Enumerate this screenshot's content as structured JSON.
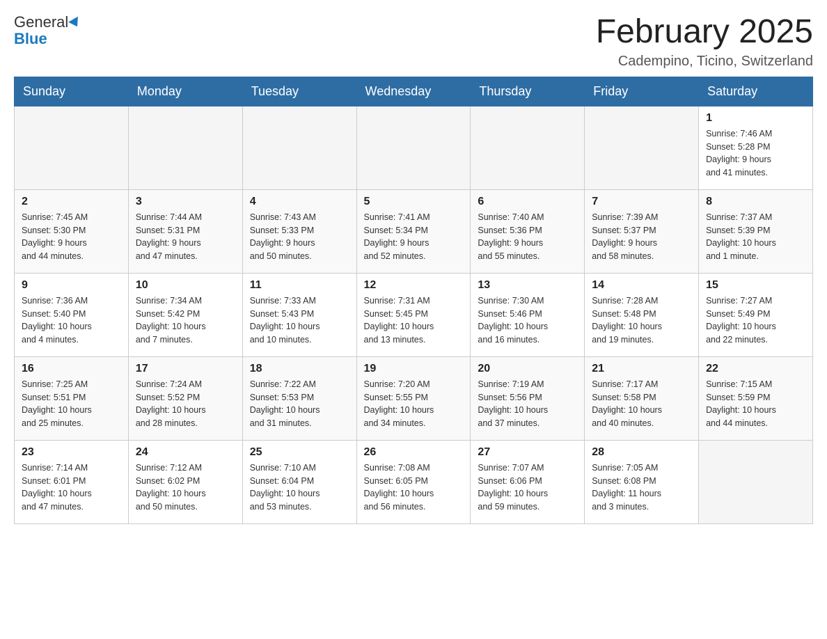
{
  "header": {
    "logo_line1": "General",
    "logo_line2": "Blue",
    "month_title": "February 2025",
    "location": "Cadempino, Ticino, Switzerland"
  },
  "days_of_week": [
    "Sunday",
    "Monday",
    "Tuesday",
    "Wednesday",
    "Thursday",
    "Friday",
    "Saturday"
  ],
  "weeks": [
    {
      "days": [
        {
          "num": "",
          "info": ""
        },
        {
          "num": "",
          "info": ""
        },
        {
          "num": "",
          "info": ""
        },
        {
          "num": "",
          "info": ""
        },
        {
          "num": "",
          "info": ""
        },
        {
          "num": "",
          "info": ""
        },
        {
          "num": "1",
          "info": "Sunrise: 7:46 AM\nSunset: 5:28 PM\nDaylight: 9 hours\nand 41 minutes."
        }
      ]
    },
    {
      "days": [
        {
          "num": "2",
          "info": "Sunrise: 7:45 AM\nSunset: 5:30 PM\nDaylight: 9 hours\nand 44 minutes."
        },
        {
          "num": "3",
          "info": "Sunrise: 7:44 AM\nSunset: 5:31 PM\nDaylight: 9 hours\nand 47 minutes."
        },
        {
          "num": "4",
          "info": "Sunrise: 7:43 AM\nSunset: 5:33 PM\nDaylight: 9 hours\nand 50 minutes."
        },
        {
          "num": "5",
          "info": "Sunrise: 7:41 AM\nSunset: 5:34 PM\nDaylight: 9 hours\nand 52 minutes."
        },
        {
          "num": "6",
          "info": "Sunrise: 7:40 AM\nSunset: 5:36 PM\nDaylight: 9 hours\nand 55 minutes."
        },
        {
          "num": "7",
          "info": "Sunrise: 7:39 AM\nSunset: 5:37 PM\nDaylight: 9 hours\nand 58 minutes."
        },
        {
          "num": "8",
          "info": "Sunrise: 7:37 AM\nSunset: 5:39 PM\nDaylight: 10 hours\nand 1 minute."
        }
      ]
    },
    {
      "days": [
        {
          "num": "9",
          "info": "Sunrise: 7:36 AM\nSunset: 5:40 PM\nDaylight: 10 hours\nand 4 minutes."
        },
        {
          "num": "10",
          "info": "Sunrise: 7:34 AM\nSunset: 5:42 PM\nDaylight: 10 hours\nand 7 minutes."
        },
        {
          "num": "11",
          "info": "Sunrise: 7:33 AM\nSunset: 5:43 PM\nDaylight: 10 hours\nand 10 minutes."
        },
        {
          "num": "12",
          "info": "Sunrise: 7:31 AM\nSunset: 5:45 PM\nDaylight: 10 hours\nand 13 minutes."
        },
        {
          "num": "13",
          "info": "Sunrise: 7:30 AM\nSunset: 5:46 PM\nDaylight: 10 hours\nand 16 minutes."
        },
        {
          "num": "14",
          "info": "Sunrise: 7:28 AM\nSunset: 5:48 PM\nDaylight: 10 hours\nand 19 minutes."
        },
        {
          "num": "15",
          "info": "Sunrise: 7:27 AM\nSunset: 5:49 PM\nDaylight: 10 hours\nand 22 minutes."
        }
      ]
    },
    {
      "days": [
        {
          "num": "16",
          "info": "Sunrise: 7:25 AM\nSunset: 5:51 PM\nDaylight: 10 hours\nand 25 minutes."
        },
        {
          "num": "17",
          "info": "Sunrise: 7:24 AM\nSunset: 5:52 PM\nDaylight: 10 hours\nand 28 minutes."
        },
        {
          "num": "18",
          "info": "Sunrise: 7:22 AM\nSunset: 5:53 PM\nDaylight: 10 hours\nand 31 minutes."
        },
        {
          "num": "19",
          "info": "Sunrise: 7:20 AM\nSunset: 5:55 PM\nDaylight: 10 hours\nand 34 minutes."
        },
        {
          "num": "20",
          "info": "Sunrise: 7:19 AM\nSunset: 5:56 PM\nDaylight: 10 hours\nand 37 minutes."
        },
        {
          "num": "21",
          "info": "Sunrise: 7:17 AM\nSunset: 5:58 PM\nDaylight: 10 hours\nand 40 minutes."
        },
        {
          "num": "22",
          "info": "Sunrise: 7:15 AM\nSunset: 5:59 PM\nDaylight: 10 hours\nand 44 minutes."
        }
      ]
    },
    {
      "days": [
        {
          "num": "23",
          "info": "Sunrise: 7:14 AM\nSunset: 6:01 PM\nDaylight: 10 hours\nand 47 minutes."
        },
        {
          "num": "24",
          "info": "Sunrise: 7:12 AM\nSunset: 6:02 PM\nDaylight: 10 hours\nand 50 minutes."
        },
        {
          "num": "25",
          "info": "Sunrise: 7:10 AM\nSunset: 6:04 PM\nDaylight: 10 hours\nand 53 minutes."
        },
        {
          "num": "26",
          "info": "Sunrise: 7:08 AM\nSunset: 6:05 PM\nDaylight: 10 hours\nand 56 minutes."
        },
        {
          "num": "27",
          "info": "Sunrise: 7:07 AM\nSunset: 6:06 PM\nDaylight: 10 hours\nand 59 minutes."
        },
        {
          "num": "28",
          "info": "Sunrise: 7:05 AM\nSunset: 6:08 PM\nDaylight: 11 hours\nand 3 minutes."
        },
        {
          "num": "",
          "info": ""
        }
      ]
    }
  ]
}
